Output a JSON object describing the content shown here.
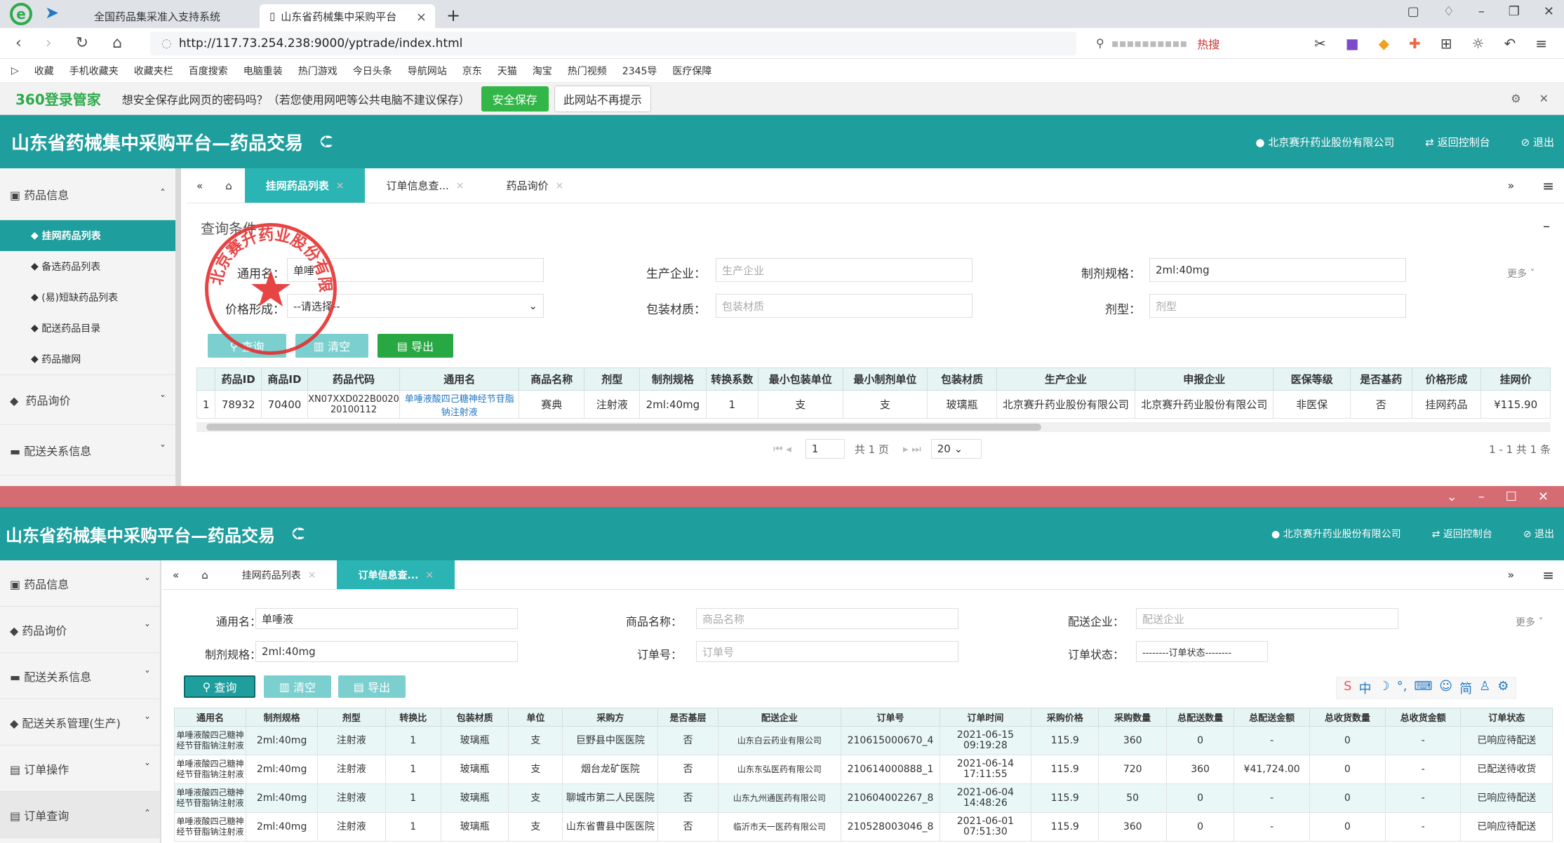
{
  "browser": {
    "tabs": [
      {
        "label": "全国药品集采准入支持系统"
      },
      {
        "label": "山东省药械集中采购平台"
      }
    ],
    "url": "http://117.73.254.238:9000/yptrade/index.html",
    "search_hot": "热搜",
    "bookmarks": [
      "收藏",
      "手机收藏夹",
      "收藏夹栏",
      "百度搜索",
      "电脑重装",
      "热门游戏",
      "今日头条",
      "导航网站",
      "京东",
      "天猫",
      "淘宝",
      "热门视频",
      "2345导",
      "医疗保障"
    ],
    "password_bar": {
      "brand": "360登录管家",
      "message": "想安全保存此网页的密码吗？（若您使用网吧等公共电脑不建议保存）",
      "save": "安全保存",
      "never": "此网站不再提示"
    }
  },
  "top": {
    "app_title": "山东省药械集中采购平台—药品交易",
    "company": "北京赛升药业股份有限公司",
    "console": "返回控制台",
    "logout": "退出",
    "sidebar": {
      "group1": "药品信息",
      "items": [
        "挂网药品列表",
        "备选药品列表",
        "(易)短缺药品列表",
        "配送药品目录",
        "药品撤网"
      ],
      "group2": "药品询价",
      "group3": "配送关系信息"
    },
    "tabs": [
      "挂网药品列表",
      "订单信息查...",
      "药品询价"
    ],
    "query_title": "查询条件",
    "form": {
      "name_label": "通用名：",
      "name_value": "单唾",
      "mfr_label": "生产企业：",
      "mfr_ph": "生产企业",
      "spec_label": "制剂规格：",
      "spec_value": "2ml:40mg",
      "price_label": "价格形成：",
      "price_value": "--请选择--",
      "pack_label": "包装材质：",
      "pack_ph": "包装材质",
      "form_label": "剂型：",
      "form_ph": "剂型",
      "more": "更多"
    },
    "buttons": {
      "query": "查询",
      "clear": "清空",
      "export": "导出"
    },
    "table": {
      "headers": [
        "",
        "药品ID",
        "商品ID",
        "药品代码",
        "通用名",
        "商品名称",
        "剂型",
        "制剂规格",
        "转换系数",
        "最小包装单位",
        "最小制剂单位",
        "包装材质",
        "生产企业",
        "申报企业",
        "医保等级",
        "是否基药",
        "价格形成",
        "挂网价"
      ],
      "rows": [
        [
          "1",
          "78932",
          "70400",
          "XN07XXD022B002020100112",
          "单唾液酸四己糖神经节苷脂钠注射液",
          "赛典",
          "注射液",
          "2ml:40mg",
          "1",
          "支",
          "支",
          "玻璃瓶",
          "北京赛升药业股份有限公司",
          "北京赛升药业股份有限公司",
          "非医保",
          "否",
          "挂网药品",
          "¥115.90"
        ]
      ]
    },
    "pager": {
      "page": "1",
      "total": "共 1 页",
      "size": "20",
      "summary": "1 - 1 共 1 条"
    }
  },
  "bottom": {
    "app_title": "山东省药械集中采购平台—药品交易",
    "company": "北京赛升药业股份有限公司",
    "console": "返回控制台",
    "logout": "退出",
    "sidebar": [
      "药品信息",
      "药品询价",
      "配送关系信息",
      "配送关系管理(生产)",
      "订单操作",
      "订单查询"
    ],
    "tabs": [
      "挂网药品列表",
      "订单信息查..."
    ],
    "form": {
      "name_label": "通用名：",
      "name_value": "单唾液",
      "trade_label": "商品名称：",
      "trade_ph": "商品名称",
      "dist_label": "配送企业：",
      "dist_ph": "配送企业",
      "spec_label": "制剂规格：",
      "spec_value": "2ml:40mg",
      "order_label": "订单号：",
      "order_ph": "订单号",
      "status_label": "订单状态：",
      "status_value": "--------订单状态--------",
      "more": "更多"
    },
    "buttons": {
      "query": "查询",
      "clear": "清空",
      "export": "导出"
    },
    "table": {
      "headers": [
        "通用名",
        "制剂规格",
        "剂型",
        "转换比",
        "包装材质",
        "单位",
        "采购方",
        "是否基层",
        "配送企业",
        "订单号",
        "订单时间",
        "采购价格",
        "采购数量",
        "总配送数量",
        "总配送金额",
        "总收货数量",
        "总收货金额",
        "订单状态"
      ],
      "rows": [
        [
          "单唾液酸四己糖神经节苷脂钠注射液",
          "2ml:40mg",
          "注射液",
          "1",
          "玻璃瓶",
          "支",
          "巨野县中医医院",
          "否",
          "山东白云药业有限公司",
          "210615000670_4",
          "2021-06-15 09:19:28",
          "115.9",
          "360",
          "0",
          "-",
          "0",
          "-",
          "已响应待配送"
        ],
        [
          "单唾液酸四己糖神经节苷脂钠注射液",
          "2ml:40mg",
          "注射液",
          "1",
          "玻璃瓶",
          "支",
          "烟台龙矿医院",
          "否",
          "山东东弘医药有限公司",
          "210614000888_1",
          "2021-06-14 17:11:55",
          "115.9",
          "720",
          "360",
          "¥41,724.00",
          "0",
          "-",
          "已配送待收货"
        ],
        [
          "单唾液酸四己糖神经节苷脂钠注射液",
          "2ml:40mg",
          "注射液",
          "1",
          "玻璃瓶",
          "支",
          "聊城市第二人民医院",
          "否",
          "山东九州通医药有限公司",
          "210604002267_8",
          "2021-06-04 14:48:26",
          "115.9",
          "50",
          "0",
          "-",
          "0",
          "-",
          "已响应待配送"
        ],
        [
          "单唾液酸四己糖神经节苷脂钠注射液",
          "2ml:40mg",
          "注射液",
          "1",
          "玻璃瓶",
          "支",
          "山东省曹县中医医院",
          "否",
          "临沂市天一医药有限公司",
          "210528003046_8",
          "2021-06-01 07:51:30",
          "115.9",
          "360",
          "0",
          "-",
          "0",
          "-",
          "已响应待配送"
        ]
      ]
    }
  },
  "stamp_text": "北京赛升药业股份有限公司",
  "colors": {
    "teal": "#1f9e9e",
    "tab_active": "#2bb4b4",
    "green": "#33b648",
    "divider": "#d56b73",
    "stamp": "#e53030"
  }
}
